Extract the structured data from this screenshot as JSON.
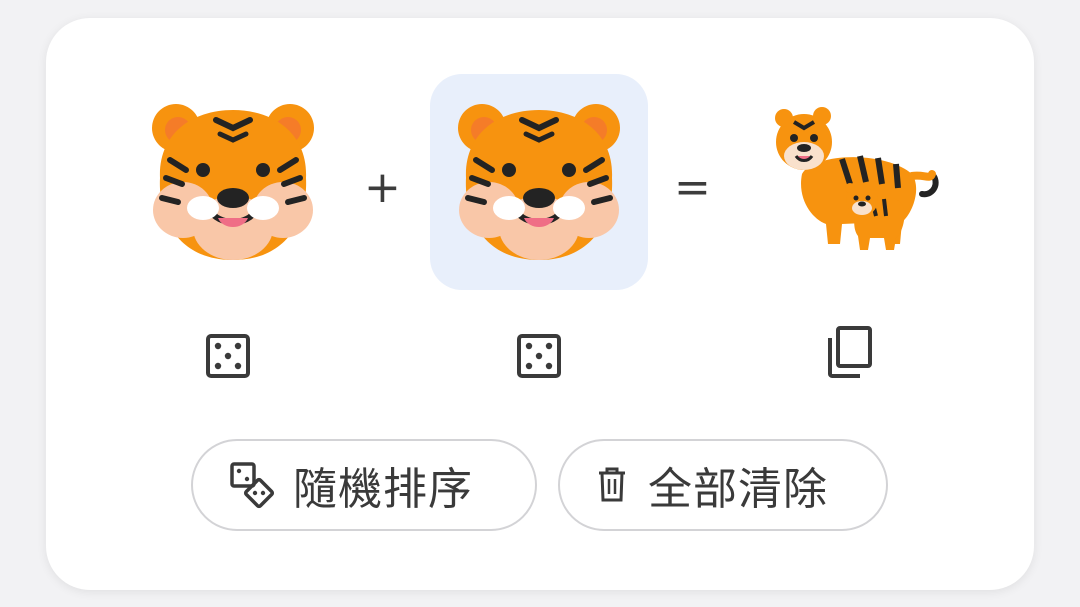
{
  "kitchen": {
    "left_emoji": {
      "name": "tiger-face",
      "char": "🐯"
    },
    "operator_plus": "+",
    "right_emoji": {
      "name": "tiger-face",
      "char": "🐯",
      "selected": true
    },
    "operator_equals": "=",
    "result": {
      "name": "tiger-with-cub"
    },
    "colors": {
      "selected_bg": "#e8effb",
      "tiger_orange": "#f7930f",
      "stripes": "#232323"
    }
  },
  "actions": {
    "left_random_icon": "dice-icon",
    "right_random_icon": "dice-icon",
    "copy_icon": "copy-icon"
  },
  "buttons": {
    "shuffle": {
      "icon": "dice-shuffle-icon",
      "label": "隨機排序"
    },
    "clear": {
      "icon": "trash-icon",
      "label": "全部清除"
    }
  }
}
